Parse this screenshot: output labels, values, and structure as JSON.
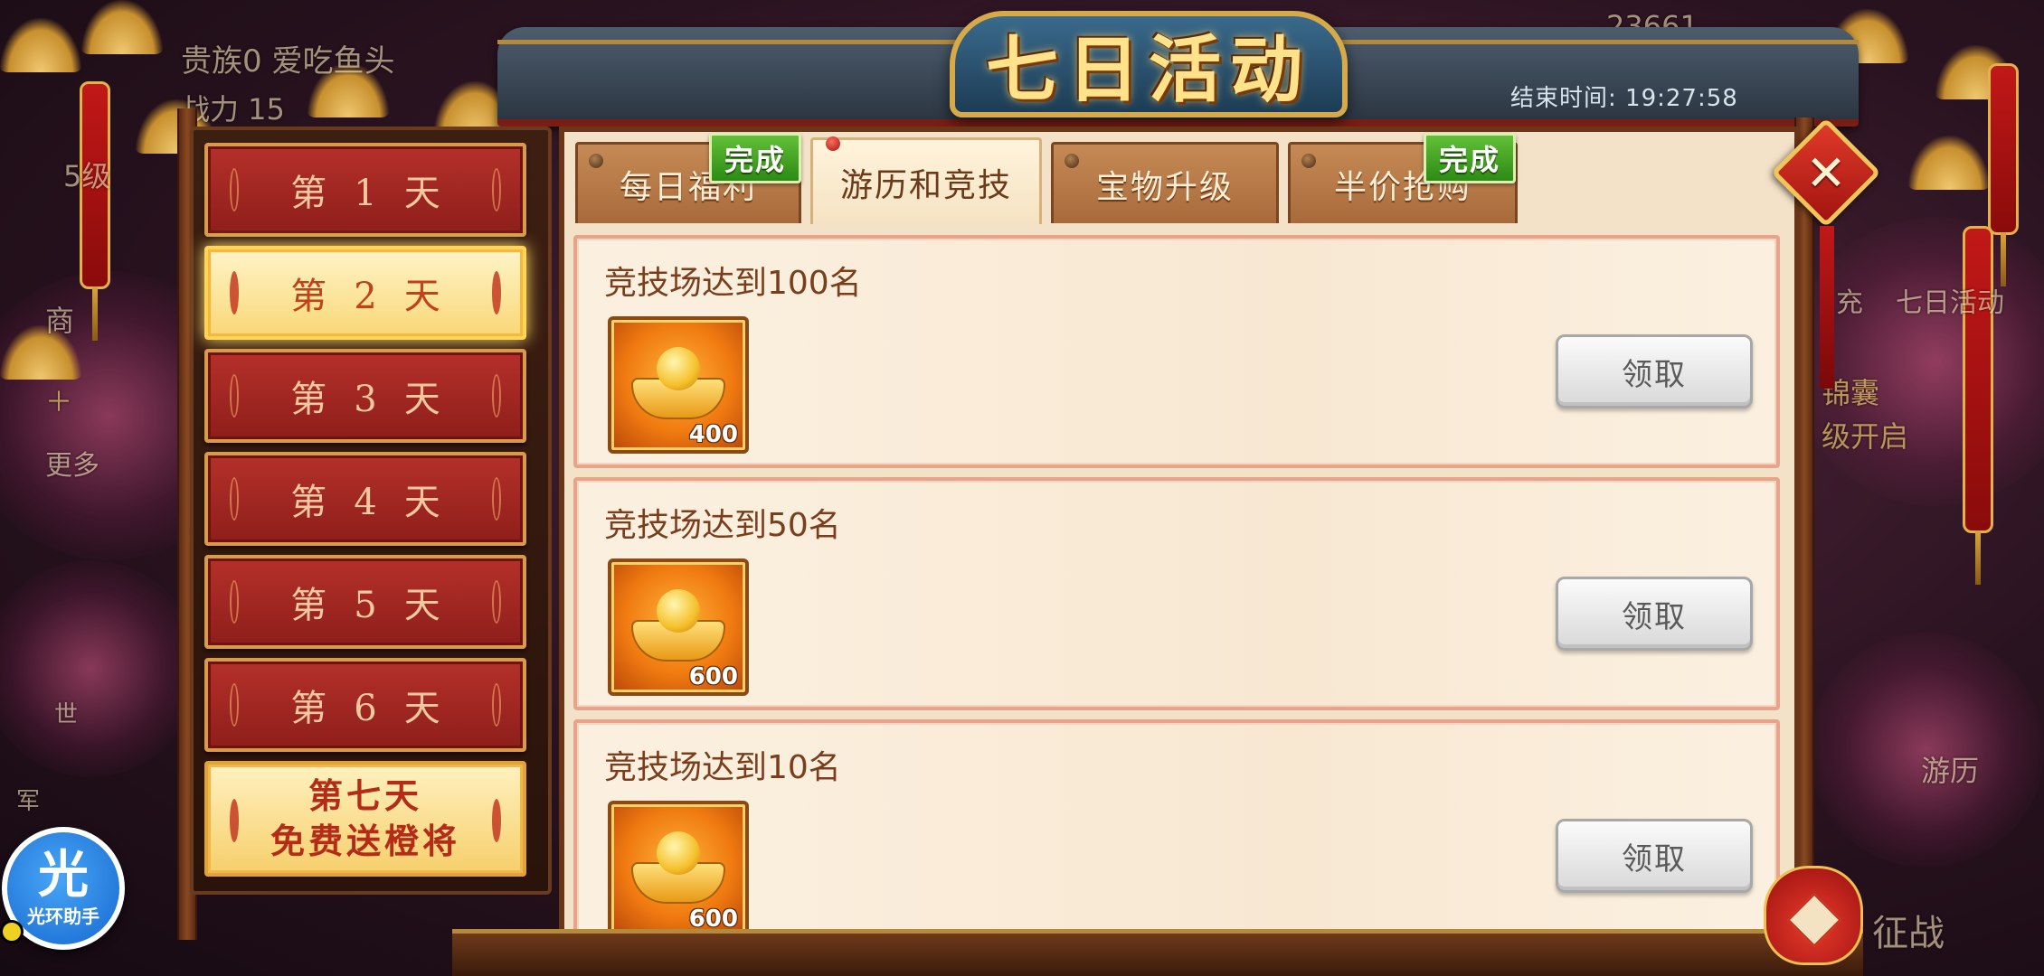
{
  "title": "七日活动",
  "end_time": "结束时间: 19:27:58",
  "close_label": "✕",
  "days": [
    {
      "label": "第1天",
      "state": "normal"
    },
    {
      "label": "第2天",
      "state": "active"
    },
    {
      "label": "第3天",
      "state": "normal"
    },
    {
      "label": "第4天",
      "state": "normal"
    },
    {
      "label": "第5天",
      "state": "normal"
    },
    {
      "label": "第6天",
      "state": "normal"
    }
  ],
  "day7": {
    "line1": "第七天",
    "line2": "免费送橙将"
  },
  "tabs": [
    {
      "label": "每日福利",
      "badge": "完成",
      "active": false
    },
    {
      "label": "游历和竞技",
      "badge": "",
      "active": true
    },
    {
      "label": "宝物升级",
      "badge": "",
      "active": false
    },
    {
      "label": "半价抢购",
      "badge": "完成",
      "active": false
    }
  ],
  "tasks": [
    {
      "title": "竞技场达到100名",
      "reward_amount": "400",
      "button": "领取"
    },
    {
      "title": "竞技场达到50名",
      "reward_amount": "600",
      "button": "领取"
    },
    {
      "title": "竞技场达到10名",
      "reward_amount": "600",
      "button": "领取"
    }
  ],
  "background": {
    "top_left_text": "贵族0 爱吃鱼头",
    "top_left_sub": "战力 15",
    "level_text": "5级",
    "shop_text": "商",
    "more_text": "更多",
    "top_number": "23661",
    "right_items": [
      "充",
      "七日活动"
    ],
    "right_banner": [
      "锦囊",
      "级开启"
    ],
    "bottom_right": [
      "游历",
      "征战"
    ],
    "left_chat": [
      "世",
      "军"
    ]
  },
  "helper": {
    "glyph": "光",
    "label": "光环助手"
  },
  "colors": {
    "accent_red": "#b5302a",
    "gold": "#ffe28a",
    "done_green": "#3a9a1c",
    "panel_bg": "#f3e2c8"
  }
}
